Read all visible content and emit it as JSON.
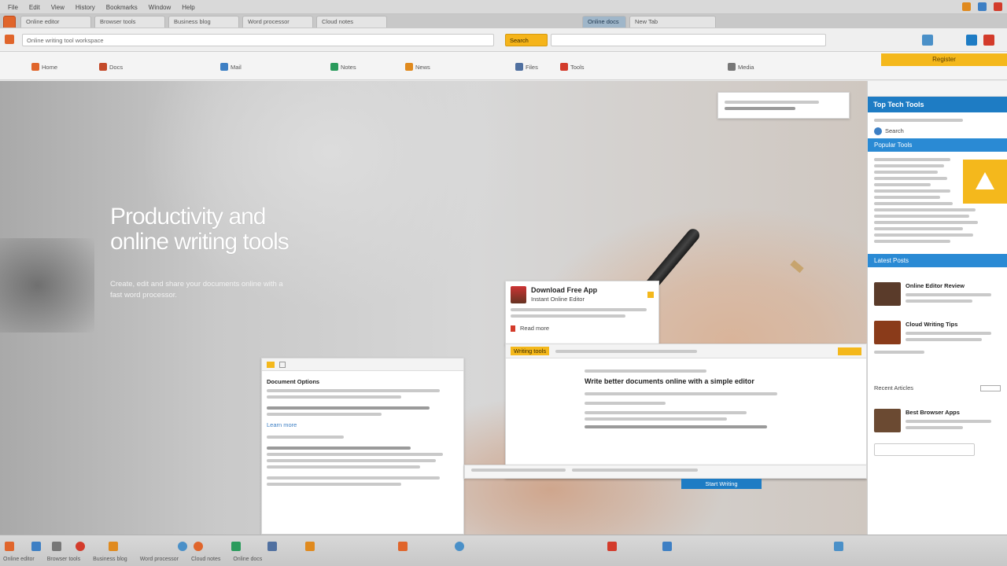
{
  "menu": [
    "File",
    "Edit",
    "View",
    "History",
    "Bookmarks",
    "Window",
    "Help"
  ],
  "tabs": [
    {
      "label": "Online editor"
    },
    {
      "label": "Browser tools"
    },
    {
      "label": "Business blog"
    },
    {
      "label": "Word processor"
    },
    {
      "label": "Cloud notes"
    },
    {
      "label": "Online docs"
    },
    {
      "label": "New Tab"
    }
  ],
  "address": {
    "url": "Online writing tool workspace",
    "search_placeholder": "Search"
  },
  "bookmarks": [
    {
      "label": "Home",
      "color": "#e0652b"
    },
    {
      "label": "Docs",
      "color": "#c44a2a"
    },
    {
      "label": "Mail",
      "color": "#3d7fc4"
    },
    {
      "label": "Notes",
      "color": "#2a9b5c"
    },
    {
      "label": "News",
      "color": "#e08a1e"
    },
    {
      "label": "Files",
      "color": "#5070a0"
    },
    {
      "label": "Tools",
      "color": "#d33b2b"
    },
    {
      "label": "Media",
      "color": "#777777"
    }
  ],
  "yellow_button": "Register",
  "hero": {
    "title": "Productivity and online writing tools",
    "subtitle": "Create, edit and share your documents online with a fast word processor."
  },
  "cards": {
    "popup_title": "Download Free App",
    "popup_sub": "Instant Online Editor",
    "popup_link": "Read more",
    "doc_left_title": "Document Options",
    "doc_left_link": "Learn more",
    "doc_mid_tag": "Writing tools",
    "doc_mid_heading": "Write better documents online with a simple editor",
    "doc_mid_button": "Start Writing"
  },
  "sidebar": {
    "header": "Top Tech Tools",
    "search_label": "Search",
    "section1": "Popular Tools",
    "section2": "Latest Posts",
    "section3": "Recent Articles",
    "posts": [
      {
        "title": "Online Editor Review",
        "color": "#5a3b2a"
      },
      {
        "title": "Cloud Writing Tips",
        "color": "#8a3b1a"
      },
      {
        "title": "Best Browser Apps",
        "color": "#6b4a32"
      }
    ]
  },
  "taskbar_colors": [
    "#e0652b",
    "#3d7fc4",
    "#2a9b5c",
    "#d33b2b",
    "#777777",
    "#5070a0",
    "#e08a1e",
    "#4a90c8"
  ],
  "accent": "#1e7cc4",
  "highlight": "#f4b81c"
}
